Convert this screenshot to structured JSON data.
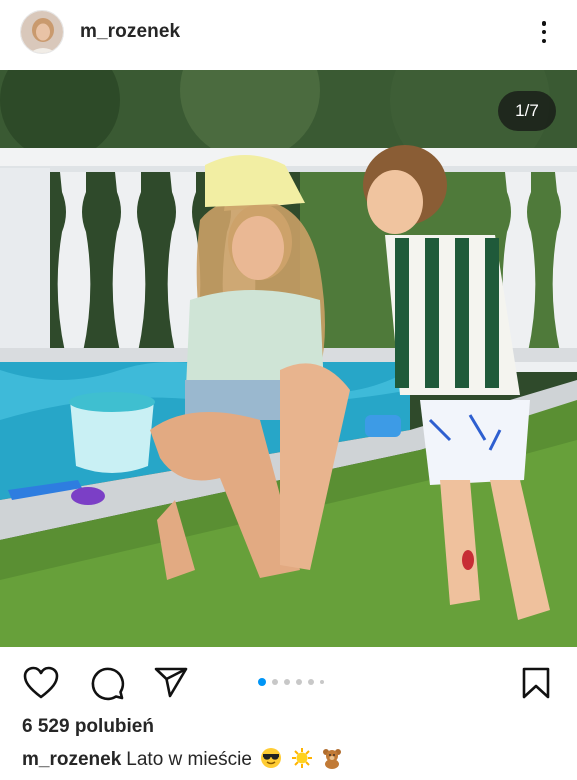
{
  "post": {
    "username": "m_rozenek",
    "image_counter": "1/7",
    "likes": "6 529 polubień",
    "caption_user": "m_rozenek",
    "caption_text": "Lato w mieście",
    "caption_emojis": [
      "sunglasses-emoji",
      "sun-emoji",
      "teddy-bear-emoji"
    ]
  },
  "carousel": {
    "total_dots": 6,
    "active_index": 0
  },
  "colors": {
    "accent_blue": "#0095f6",
    "text": "#262626"
  },
  "icons": [
    "heart-icon",
    "comment-icon",
    "share-icon",
    "bookmark-icon",
    "more-icon"
  ]
}
